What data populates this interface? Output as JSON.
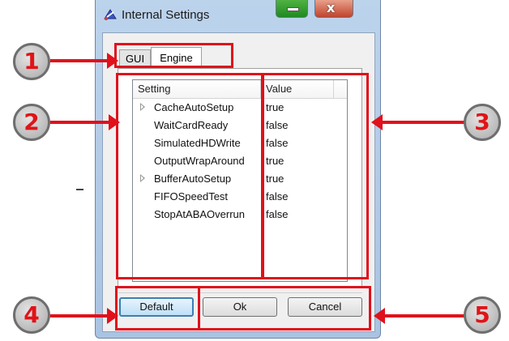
{
  "window": {
    "title": "Internal Settings",
    "close_glyph": "x",
    "app_icon": "settings-app-icon"
  },
  "tabs": [
    {
      "label": "GUI",
      "selected": false
    },
    {
      "label": "Engine",
      "selected": true
    }
  ],
  "table": {
    "columns": [
      "Setting",
      "Value"
    ],
    "rows": [
      {
        "setting": "CacheAutoSetup",
        "value": "true",
        "expandable": true
      },
      {
        "setting": "WaitCardReady",
        "value": "false",
        "expandable": false
      },
      {
        "setting": "SimulatedHDWrite",
        "value": "false",
        "expandable": false
      },
      {
        "setting": "OutputWrapAround",
        "value": "true",
        "expandable": false
      },
      {
        "setting": "BufferAutoSetup",
        "value": "true",
        "expandable": true
      },
      {
        "setting": "FIFOSpeedTest",
        "value": "false",
        "expandable": false
      },
      {
        "setting": "StopAtABAOverrun",
        "value": "false",
        "expandable": false
      }
    ]
  },
  "buttons": {
    "default": "Default",
    "ok": "Ok",
    "cancel": "Cancel"
  },
  "callouts": [
    "1",
    "2",
    "3",
    "4",
    "5"
  ],
  "colors": {
    "highlight": "#e0111b",
    "default_button_border": "#3c7fb1"
  }
}
